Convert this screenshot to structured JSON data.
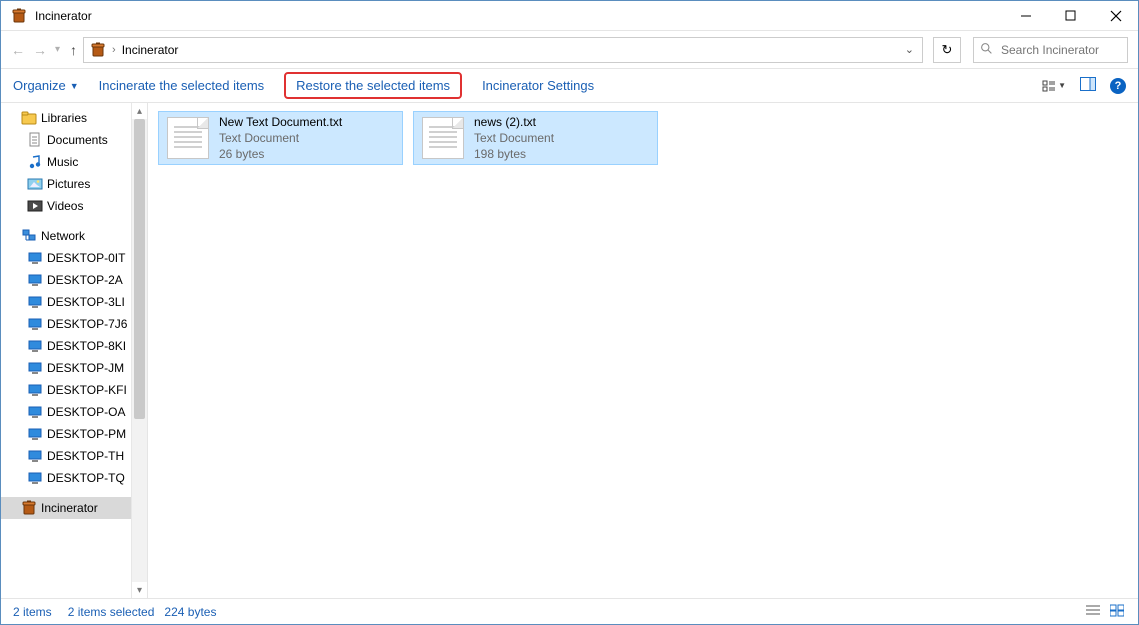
{
  "window": {
    "title": "Incinerator"
  },
  "breadcrumb": {
    "location": "Incinerator"
  },
  "search": {
    "placeholder": "Search Incinerator"
  },
  "commands": {
    "organize": "Organize",
    "incinerate": "Incinerate the selected items",
    "restore": "Restore the selected items",
    "settings": "Incinerator Settings"
  },
  "nav": {
    "libraries": {
      "label": "Libraries",
      "children": [
        {
          "label": "Documents",
          "icon": "documents"
        },
        {
          "label": "Music",
          "icon": "music"
        },
        {
          "label": "Pictures",
          "icon": "pictures"
        },
        {
          "label": "Videos",
          "icon": "videos"
        }
      ]
    },
    "network": {
      "label": "Network",
      "children": [
        {
          "label": "DESKTOP-0IT"
        },
        {
          "label": "DESKTOP-2A"
        },
        {
          "label": "DESKTOP-3LI"
        },
        {
          "label": "DESKTOP-7J6"
        },
        {
          "label": "DESKTOP-8KI"
        },
        {
          "label": "DESKTOP-JM"
        },
        {
          "label": "DESKTOP-KFI"
        },
        {
          "label": "DESKTOP-OA"
        },
        {
          "label": "DESKTOP-PM"
        },
        {
          "label": "DESKTOP-TH"
        },
        {
          "label": "DESKTOP-TQ"
        }
      ]
    },
    "incinerator_label": "Incinerator"
  },
  "files": [
    {
      "name": "New Text Document.txt",
      "type": "Text Document",
      "size": "26 bytes"
    },
    {
      "name": "news (2).txt",
      "type": "Text Document",
      "size": "198 bytes"
    }
  ],
  "status": {
    "count": "2 items",
    "selected": "2 items selected",
    "size": "224 bytes"
  }
}
